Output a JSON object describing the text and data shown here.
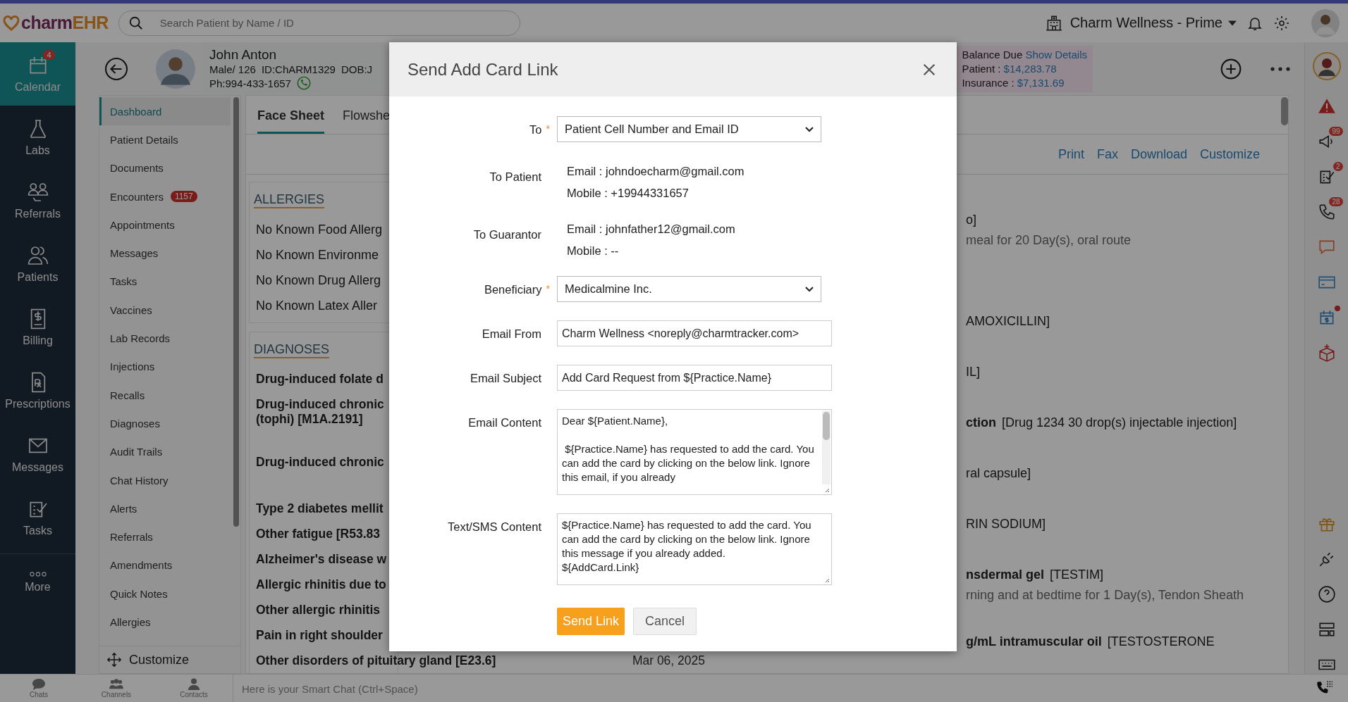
{
  "topbar": {
    "logo_a": "charm",
    "logo_b": "EHR",
    "search": {
      "placeholder": "Search Patient by Name / ID"
    },
    "practice": "Charm Wellness - Prime"
  },
  "nav": [
    {
      "kind": "calendar",
      "label": "Calendar",
      "badge": "4",
      "selected": true
    },
    {
      "kind": "labs",
      "label": "Labs",
      "selected": false
    },
    {
      "kind": "referrals",
      "label": "Referrals",
      "selected": false
    },
    {
      "kind": "patients",
      "label": "Patients",
      "selected": false
    },
    {
      "kind": "billing",
      "label": "Billing",
      "selected": false
    },
    {
      "kind": "prescriptions",
      "label": "Prescriptions",
      "selected": false
    },
    {
      "kind": "messages",
      "label": "Messages",
      "selected": false
    },
    {
      "kind": "tasks",
      "label": "Tasks",
      "selected": false
    },
    {
      "kind": "more",
      "label": "More",
      "selected": false
    }
  ],
  "patient": {
    "name": "John Anton",
    "sex_age": "Male/ 126",
    "id": "ID:ChARM1329",
    "dob": "DOB:J",
    "phone": "Ph:994-433-1657",
    "balance": {
      "title": "Balance Due",
      "link": "Show Details",
      "patient_label": "Patient :",
      "patient_amount": "$14,283.78",
      "insurance_label": "Insurance :",
      "insurance_amount": "$7,131.69"
    }
  },
  "submenu": [
    {
      "label": "Dashboard",
      "selected": true
    },
    {
      "label": "Patient Details",
      "selected": false
    },
    {
      "label": "Documents",
      "selected": false
    },
    {
      "label": "Encounters",
      "badge": "1157",
      "selected": false
    },
    {
      "label": "Appointments",
      "selected": false
    },
    {
      "label": "Messages",
      "selected": false
    },
    {
      "label": "Tasks",
      "selected": false
    },
    {
      "label": "Vaccines",
      "selected": false
    },
    {
      "label": "Lab Records",
      "selected": false
    },
    {
      "label": "Injections",
      "selected": false
    },
    {
      "label": "Recalls",
      "selected": false
    },
    {
      "label": "Diagnoses",
      "selected": false
    },
    {
      "label": "Audit Trails",
      "selected": false
    },
    {
      "label": "Chat History",
      "selected": false
    },
    {
      "label": "Alerts",
      "selected": false
    },
    {
      "label": "Referrals",
      "selected": false
    },
    {
      "label": "Amendments",
      "selected": false
    },
    {
      "label": "Quick Notes",
      "selected": false
    },
    {
      "label": "Allergies",
      "selected": false
    }
  ],
  "submenu_customize": "Customize",
  "tabs": [
    {
      "label": "Face Sheet",
      "selected": true
    },
    {
      "label": "Flowshe",
      "selected": false
    }
  ],
  "actions": [
    "Print",
    "Fax",
    "Download",
    "Customize"
  ],
  "allergies": {
    "title": "ALLERGIES",
    "items": [
      "No Known Food Allerg",
      "No Known Environme",
      "No Known Drug Allerg",
      "No Known Latex Aller"
    ]
  },
  "diagnoses": {
    "title": "DIAGNOSES",
    "items": [
      {
        "text": "Drug-induced folate d"
      },
      {
        "text": "Drug-induced chronic\n(tophi) [M1A.2191]"
      },
      {
        "text": "Drug-induced chronic"
      },
      {
        "text": "Type 2 diabetes mellit"
      },
      {
        "text": "Other fatigue [R53.83"
      },
      {
        "text": "Alzheimer's disease w"
      },
      {
        "text": "Allergic rhinitis due to"
      },
      {
        "text": "Other allergic rhinitis"
      },
      {
        "text": "Pain in right shoulder"
      },
      {
        "text": "Other disorders of pituitary gland [E23.6]",
        "date": "Mar 06, 2025"
      }
    ]
  },
  "medications": [
    {
      "drug": "o]",
      "sig": "meal for 20 Day(s), oral route"
    },
    {
      "drug": "AMOXICILLIN]"
    },
    {
      "drug": "IL]"
    },
    {
      "name": "ction",
      "drug": "[Drug 1234 30 drop(s) injectable injection]"
    },
    {
      "drug": "ral capsule]"
    },
    {
      "drug": "RIN SODIUM]"
    },
    {
      "name": "nsdermal gel",
      "drug": "[TESTIM]",
      "sig": "rning and at bedtime for 1 Day(s), Tendon Sheath"
    },
    {
      "name": "g/mL intramuscular oil",
      "drug": "[TESTOSTERONE"
    }
  ],
  "rail": [
    {
      "kind": "avatar"
    },
    {
      "kind": "alert"
    },
    {
      "kind": "announce",
      "badge": "99"
    },
    {
      "kind": "checklist",
      "badge": "2"
    },
    {
      "kind": "phone",
      "badge": "28"
    },
    {
      "kind": "chat"
    },
    {
      "kind": "card"
    },
    {
      "kind": "calendar-dollar",
      "dot": true
    },
    {
      "kind": "medical-box"
    },
    {
      "kind": "gap"
    },
    {
      "kind": "gift"
    },
    {
      "kind": "plug"
    },
    {
      "kind": "help"
    },
    {
      "kind": "layout"
    },
    {
      "kind": "keyboard"
    }
  ],
  "modal": {
    "title": "Send Add Card Link",
    "rows": [
      {
        "kind": "select",
        "label": "To",
        "mark": "*",
        "value": "Patient Cell Number and Email ID"
      },
      {
        "kind": "info",
        "label": "To Patient",
        "lines": [
          "Email : johndoecharm@gmail.com",
          "Mobile : +19944331657"
        ]
      },
      {
        "kind": "info",
        "label": "To Guarantor",
        "lines": [
          "Email : johnfather12@gmail.com",
          "Mobile : --"
        ]
      },
      {
        "kind": "select",
        "label": "Beneficiary",
        "mark": "*",
        "value": "Medicalmine Inc."
      },
      {
        "kind": "input",
        "label": "Email From",
        "value": "Charm Wellness <noreply@charmtracker.com>"
      },
      {
        "kind": "input",
        "label": "Email Subject",
        "value": "Add Card Request from ${Practice.Name}"
      },
      {
        "kind": "scroll-textarea",
        "label": "Email Content",
        "value": "Dear ${Patient.Name},\n\n ${Practice.Name} has requested to add the card. You can add the card by clicking on the below link. Ignore this email, if you already"
      },
      {
        "kind": "textarea",
        "label": "Text/SMS Content",
        "value": "${Practice.Name} has requested to add the card. You can add the card by clicking on the below link. Ignore this message if you already added.\n${AddCard.Link}"
      }
    ],
    "primary": "Send Link",
    "secondary": "Cancel"
  },
  "bottom": {
    "tabs": [
      {
        "kind": "chats",
        "label": "Chats"
      },
      {
        "kind": "channels",
        "label": "Channels"
      },
      {
        "kind": "contacts",
        "label": "Contacts"
      }
    ],
    "placeholder": "Here is your Smart Chat (Ctrl+Space)"
  }
}
